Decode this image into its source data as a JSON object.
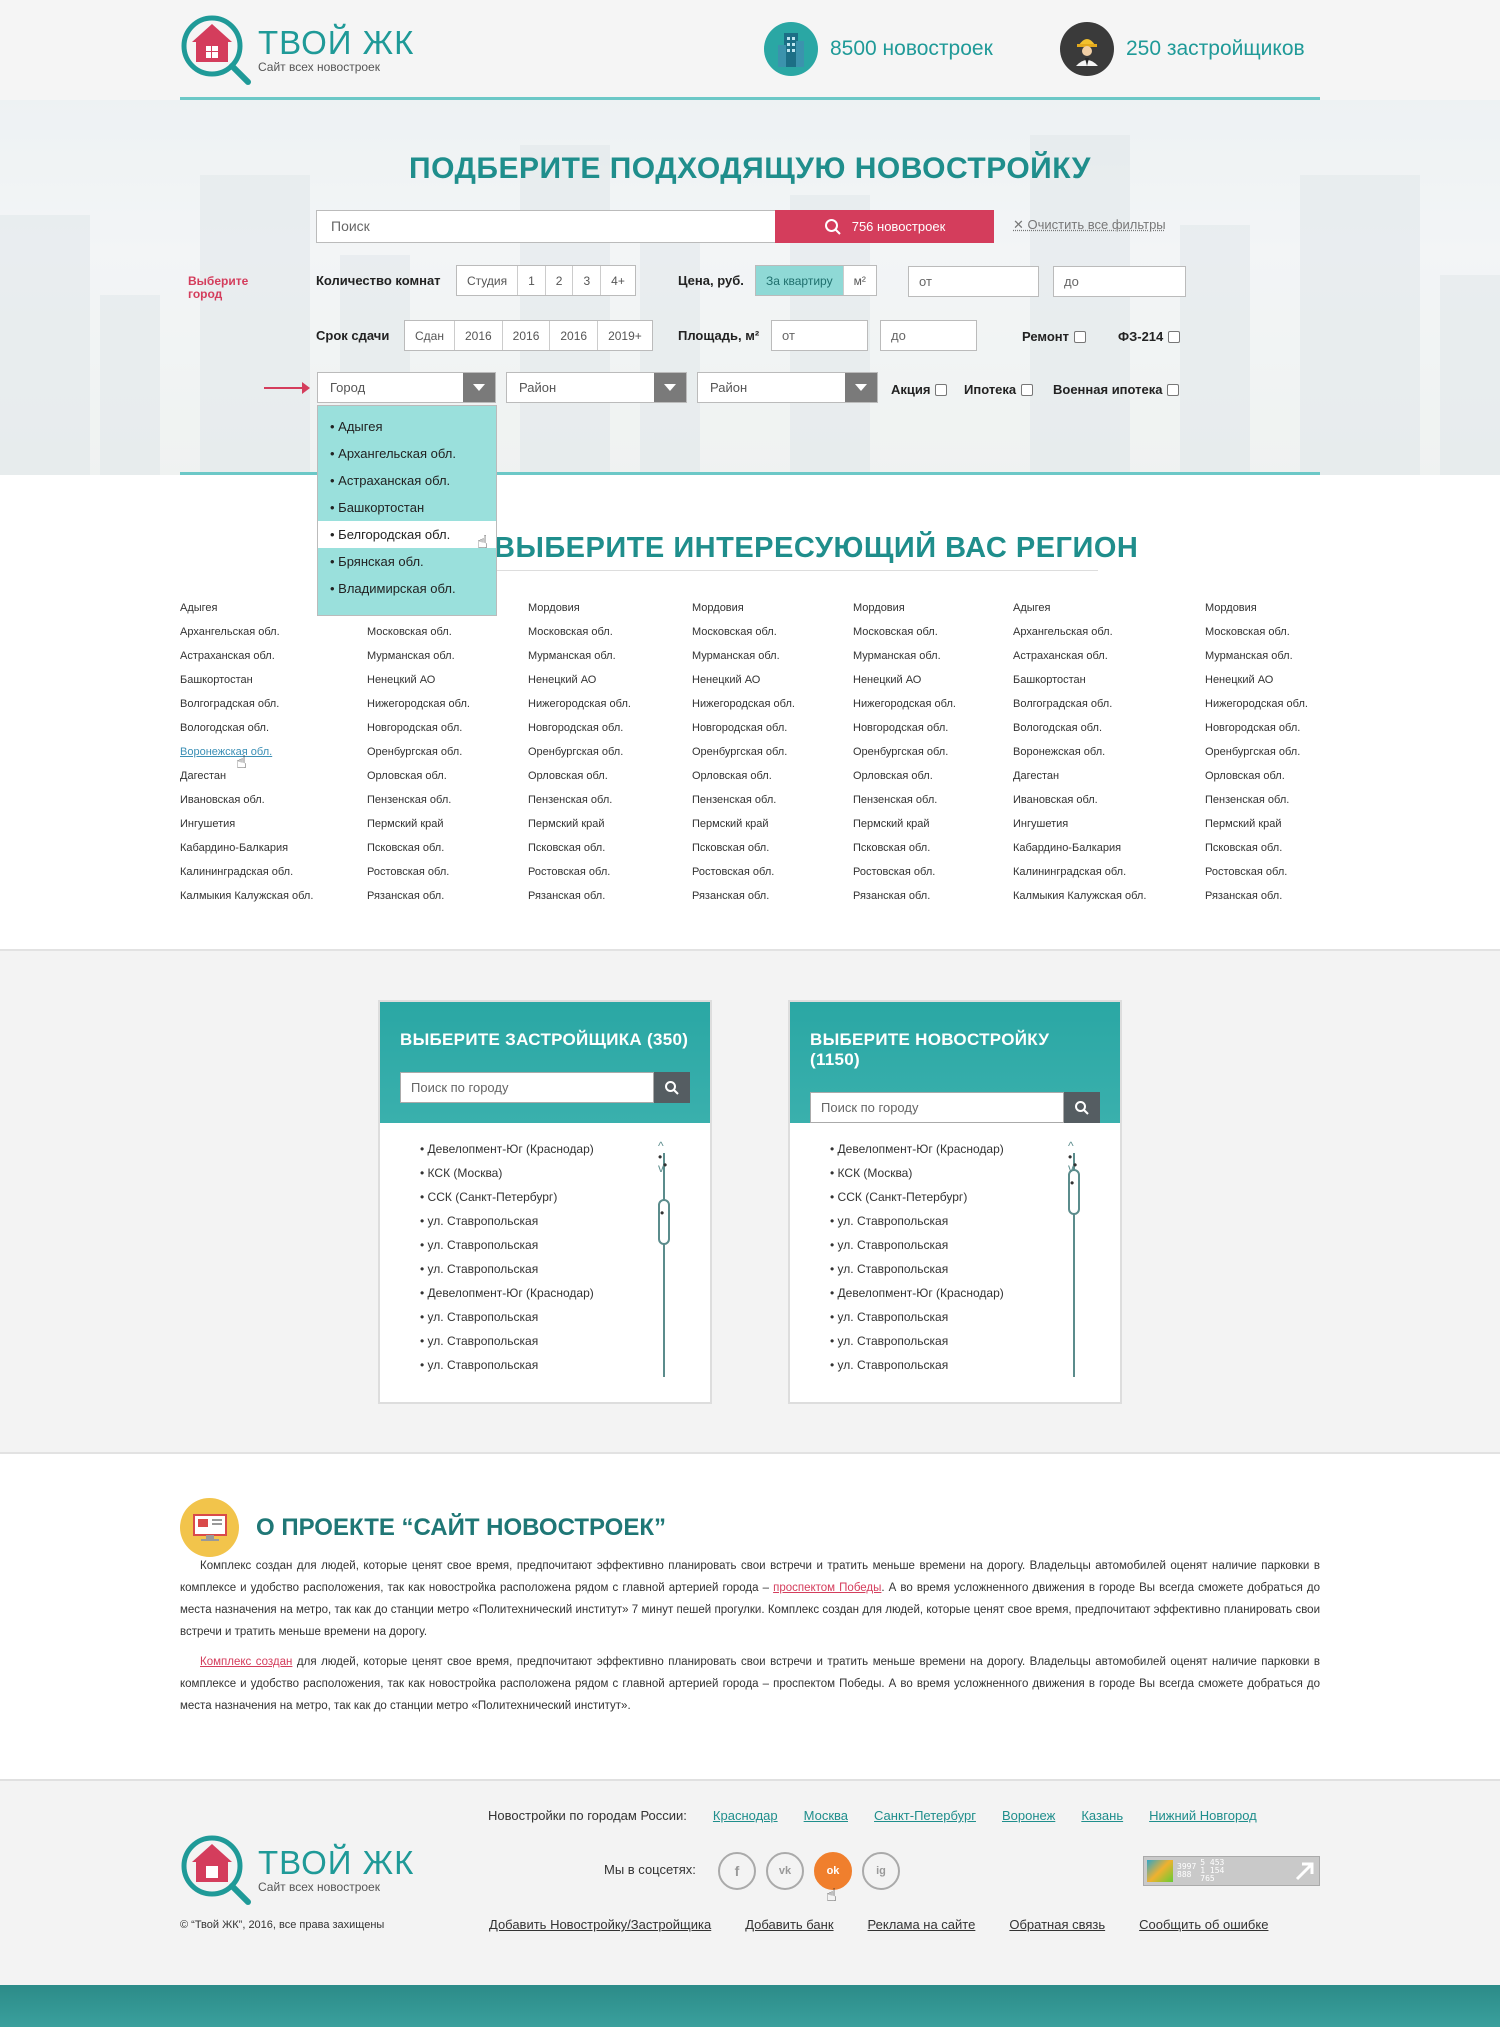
{
  "header": {
    "logo_title": "ТВОЙ ЖК",
    "logo_sub": "Сайт всех новостроек",
    "stat_buildings": "8500 новостроек",
    "stat_developers": "250 застройщиков"
  },
  "hero": {
    "title": "ПОДБЕРИТЕ ПОДХОДЯЩУЮ НОВОСТРОЙКУ",
    "search_placeholder": "Поиск",
    "search_button": "756 новостроек",
    "clear_filters": "Очистить все фильтры",
    "rooms_label": "Количество комнат",
    "rooms": [
      "Студия",
      "1",
      "2",
      "3",
      "4+"
    ],
    "price_label": "Цена, руб.",
    "price_modes": [
      "За квартиру",
      "м²"
    ],
    "price_from": "от",
    "price_to": "до",
    "deadline_label": "Срок сдачи",
    "deadlines": [
      "Сдан",
      "2016",
      "2016",
      "2016",
      "2019+"
    ],
    "area_label": "Площадь, м²",
    "area_from": "от",
    "area_to": "до",
    "repair_label": "Ремонт",
    "fz_label": "ФЗ-214",
    "choose_city_hint": "Выберите город",
    "city_select": "Город",
    "district_select_1": "Район",
    "district_select_2": "Район",
    "promo_label": "Акция",
    "mortgage_label": "Ипотека",
    "military_label": "Военная ипотека"
  },
  "dropdown": {
    "items": [
      "Адыгея",
      "Архангельская обл.",
      "Астраханская обл.",
      "Башкортостан",
      "Белгородская обл.",
      "Брянская обл.",
      "Владимирская обл."
    ],
    "hover_index": 4
  },
  "regions": {
    "title": "ВЫБЕРИТЕ ИНТЕРЕСУЮЩИЙ ВАС РЕГИОН",
    "columns": [
      [
        "Адыгея",
        "Архангельская обл.",
        "Астраханская обл.",
        "Башкортостан",
        "Волгоградская обл.",
        "Вологодская обл.",
        "Воронежская обл.",
        "Дагестан",
        "Ивановская обл.",
        "Ингушетия",
        "Кабардино-Балкария",
        "Калининградская обл.",
        "Калмыкия Калужская обл."
      ],
      [
        "",
        "Московская обл.",
        "Мурманская обл.",
        "Ненецкий АО",
        "Нижегородская обл.",
        "Новгородская обл.",
        "Оренбургская обл.",
        "Орловская обл.",
        "Пензенская обл.",
        "Пермский край",
        "Псковская обл.",
        "Ростовская обл.",
        "Рязанская обл."
      ],
      [
        "Мордовия",
        "Московская обл.",
        "Мурманская обл.",
        "Ненецкий АО",
        "Нижегородская обл.",
        "Новгородская обл.",
        "Оренбургская обл.",
        "Орловская обл.",
        "Пензенская обл.",
        "Пермский край",
        "Псковская обл.",
        "Ростовская обл.",
        "Рязанская обл."
      ],
      [
        "Мордовия",
        "Московская обл.",
        "Мурманская обл.",
        "Ненецкий АО",
        "Нижегородская обл.",
        "Новгородская обл.",
        "Оренбургская обл.",
        "Орловская обл.",
        "Пензенская обл.",
        "Пермский край",
        "Псковская обл.",
        "Ростовская обл.",
        "Рязанская обл."
      ],
      [
        "Мордовия",
        "Московская обл.",
        "Мурманская обл.",
        "Ненецкий АО",
        "Нижегородская обл.",
        "Новгородская обл.",
        "Оренбургская обл.",
        "Орловская обл.",
        "Пензенская обл.",
        "Пермский край",
        "Псковская обл.",
        "Ростовская обл.",
        "Рязанская обл."
      ],
      [
        "Адыгея",
        "Архангельская обл.",
        "Астраханская обл.",
        "Башкортостан",
        "Волгоградская обл.",
        "Вологодская обл.",
        "Воронежская обл.",
        "Дагестан",
        "Ивановская обл.",
        "Ингушетия",
        "Кабардино-Балкария",
        "Калининградская обл.",
        "Калмыкия Калужская обл."
      ],
      [
        "Мордовия",
        "Московская обл.",
        "Мурманская обл.",
        "Ненецкий АО",
        "Нижегородская обл.",
        "Новгородская обл.",
        "Оренбургская обл.",
        "Орловская обл.",
        "Пензенская обл.",
        "Пермский край",
        "Псковская обл.",
        "Ростовская обл.",
        "Рязанская обл."
      ]
    ]
  },
  "developers_card": {
    "title": "ВЫБЕРИТЕ ЗАСТРОЙЩИКА (350)",
    "search_placeholder": "Поиск по городу",
    "items": [
      "Девелопмент-Юг (Краснодар)",
      "КСК (Москва)",
      "ССК (Санкт-Петербург)",
      "ул. Ставропольская",
      "ул. Ставропольская",
      "ул. Ставропольская",
      "Девелопмент-Юг (Краснодар)",
      "ул. Ставропольская",
      "ул. Ставропольская",
      "ул. Ставропольская"
    ]
  },
  "buildings_card": {
    "title": "ВЫБЕРИТЕ НОВОСТРОЙКУ (1150)",
    "search_placeholder": "Поиск по городу",
    "items": [
      "Девелопмент-Юг (Краснодар)",
      "КСК (Москва)",
      "ССК (Санкт-Петербург)",
      "ул. Ставропольская",
      "ул. Ставропольская",
      "ул. Ставропольская",
      "Девелопмент-Юг (Краснодар)",
      "ул. Ставропольская",
      "ул. Ставропольская",
      "ул. Ставропольская"
    ]
  },
  "about": {
    "title": "О ПРОЕКТЕ “САЙТ НОВОСТРОЕК”",
    "p1_a": "Комплекс создан для людей, которые ценят свое время, предпочитают эффективно планировать свои встречи и тратить меньше времени на дорогу. Владельцы автомобилей оценят наличие парковки в комплексе и удобство расположения, так как новостройка расположена рядом с главной артерией города – ",
    "p1_link": "проспектом Победы",
    "p1_b": ". А во время усложненного движения в городе Вы всегда сможете добраться до места назначения на метро, так как до станции метро «Политехнический институт» 7 минут пешей прогулки. Комплекс создан для людей, которые ценят свое время, предпочитают эффективно планировать свои встречи и тратить меньше времени на дорогу.",
    "p2_link": "Комплекс создан",
    "p2_b": " для людей, которые ценят свое время, предпочитают эффективно планировать свои встречи и тратить меньше времени на дорогу. Владельцы автомобилей оценят наличие парковки в комплексе и удобство расположения, так как новостройка расположена рядом с главной артерией города – проспектом Победы. А во время усложненного движения в городе Вы всегда сможете добраться до места назначения на метро, так как до станции метро «Политехнический институт»."
  },
  "footer": {
    "cities_label": "Новостройки по городам России:",
    "cities": [
      "Краснодар",
      "Москва",
      "Санкт-Петербург",
      "Воронеж",
      "Казань",
      "Нижний Новгород"
    ],
    "social_label": "Мы в соцсетях:",
    "social": [
      "f",
      "vk",
      "ok",
      "ig"
    ],
    "counter_lines": [
      "3997",
      "888",
      "5 453",
      "1 154",
      "765"
    ],
    "copyright": "© “Твой ЖК”,  2016, все права захищены",
    "links": [
      "Добавить Новостройку/Застройщика",
      "Добавить банк",
      "Реклама на сайте",
      "Обратная связь",
      "Сообщить об ошибке"
    ]
  },
  "colors": {
    "teal": "#1f9a98",
    "accent_red": "#d43d5c",
    "light_teal": "#8fd9d6"
  }
}
